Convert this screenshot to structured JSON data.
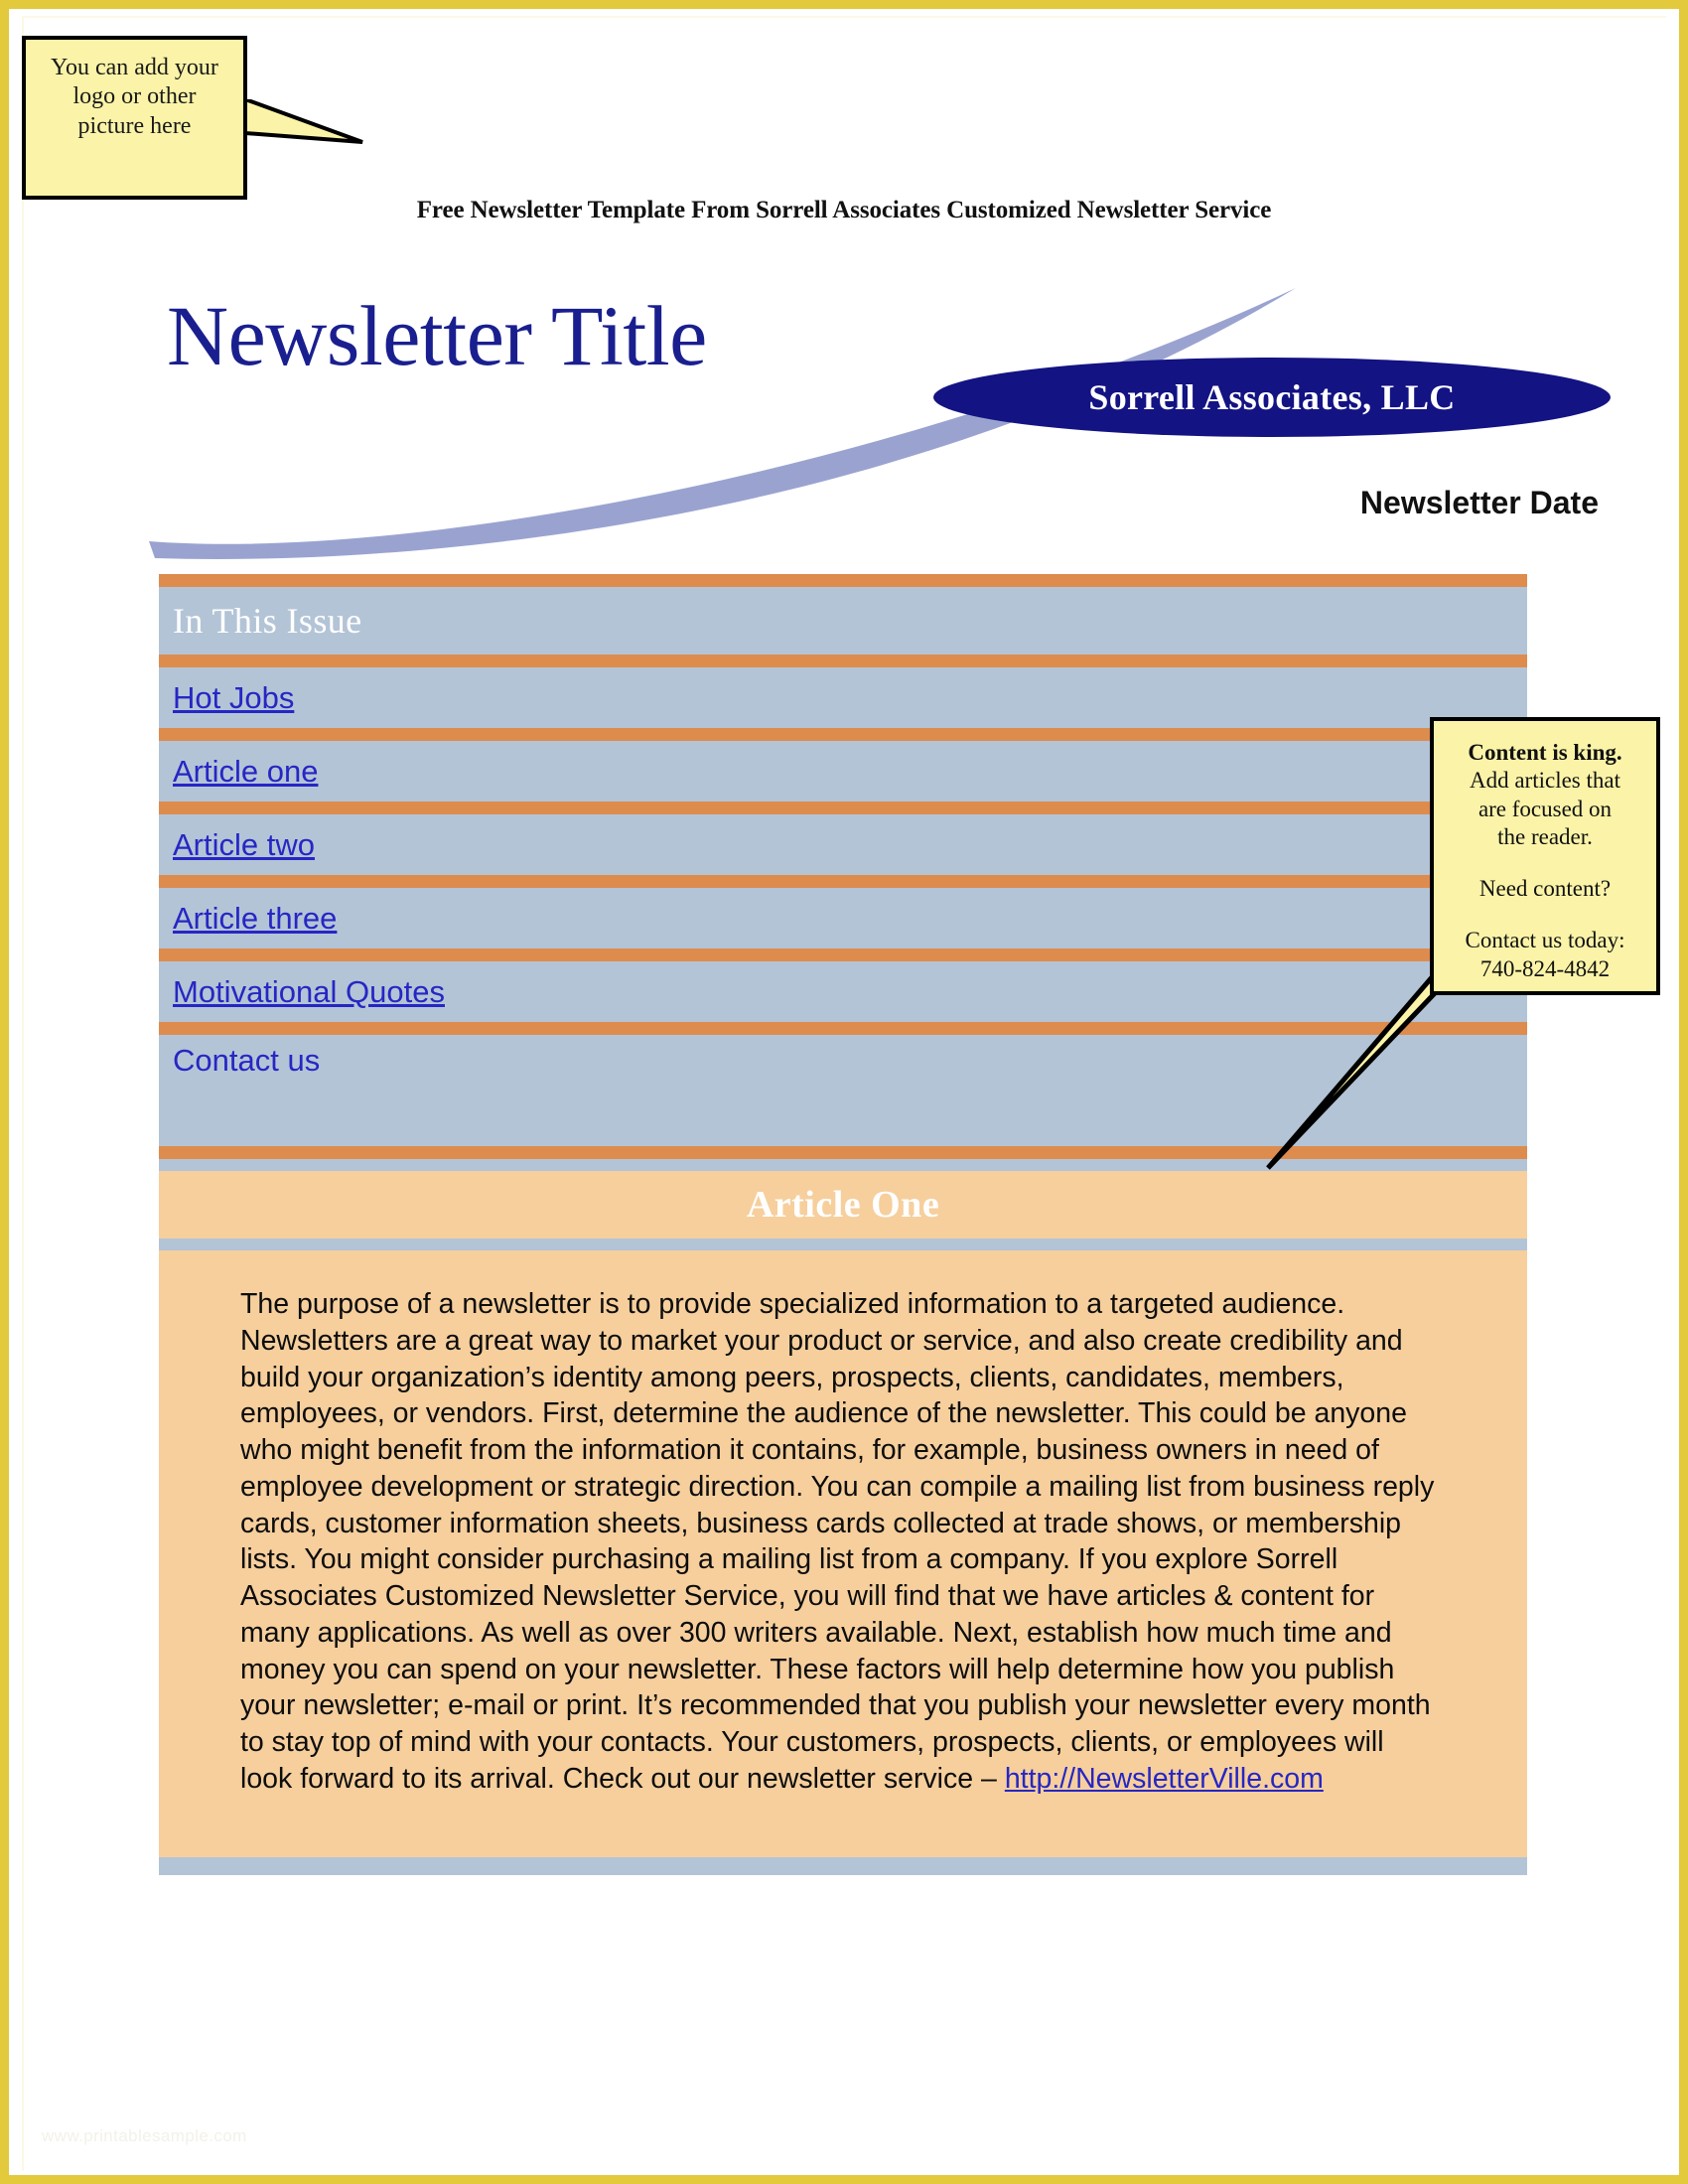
{
  "page": {
    "border_color": "#e3c93c",
    "background": "#ffffff",
    "watermark": "www.printablesample.com"
  },
  "logo_callout": {
    "text": "You can add your logo or other picture here",
    "background": "#fbf4a8",
    "border_color": "#000000"
  },
  "template_line": "Free Newsletter Template From Sorrell Associates Customized Newsletter Service",
  "masthead": {
    "title": "Newsletter Title",
    "title_color": "#1a1f8f",
    "brand": "Sorrell Associates, LLC",
    "brand_bg": "#131383",
    "brand_text_color": "#ffffff",
    "date": "Newsletter Date",
    "swoosh_color": "#9aa3d0"
  },
  "in_this_issue": {
    "header": "In This Issue",
    "header_color": "#ffffff",
    "row_bg": "#b3c4d6",
    "separator_color": "#dd8c4e",
    "link_color": "#2626c4",
    "items": [
      {
        "label": "Hot Jobs",
        "is_link": true
      },
      {
        "label": "Article one",
        "is_link": true
      },
      {
        "label": "Article two",
        "is_link": true
      },
      {
        "label": "Article three",
        "is_link": true
      },
      {
        "label": "Motivational Quotes",
        "is_link": true
      },
      {
        "label": "Contact us",
        "is_link": false
      }
    ]
  },
  "article": {
    "title": "Article One",
    "title_bg": "#f6cf9d",
    "title_color": "#ffffff",
    "body_bg": "#f6cf9d",
    "body_text": "The purpose of a newsletter is to provide specialized information to a targeted audience. Newsletters are a great way to market your product or service, and also create credibility and build your organization’s identity among peers, prospects, clients, candidates, members, employees, or vendors. First, determine the audience of the newsletter. This could be anyone who might benefit from the information it contains, for example, business owners in need of employee development or strategic direction. You can compile a mailing list from business reply cards, customer information sheets, business cards collected at trade shows, or membership lists. You might consider purchasing a mailing list from a company. If you explore Sorrell Associates Customized Newsletter Service, you will find that we have articles & content for many applications. As well as over 300 writers available. Next, establish how much time and money you can spend on your newsletter. These factors will help determine how you publish your newsletter; e-mail or print. It’s recommended that you publish your newsletter every month to stay top of mind with your contacts. Your customers, prospects, clients, or employees will look forward to its arrival. Check out our newsletter service – ",
    "body_link": "http://NewsletterVille.com"
  },
  "content_callout": {
    "headline": "Content is king.",
    "line1": "Add articles that",
    "line2": "are focused on",
    "line3": "the reader.",
    "question": "Need content?",
    "contact_label": "Contact us today:",
    "phone": "740-824-4842",
    "background": "#fbf4a8",
    "border_color": "#000000"
  }
}
